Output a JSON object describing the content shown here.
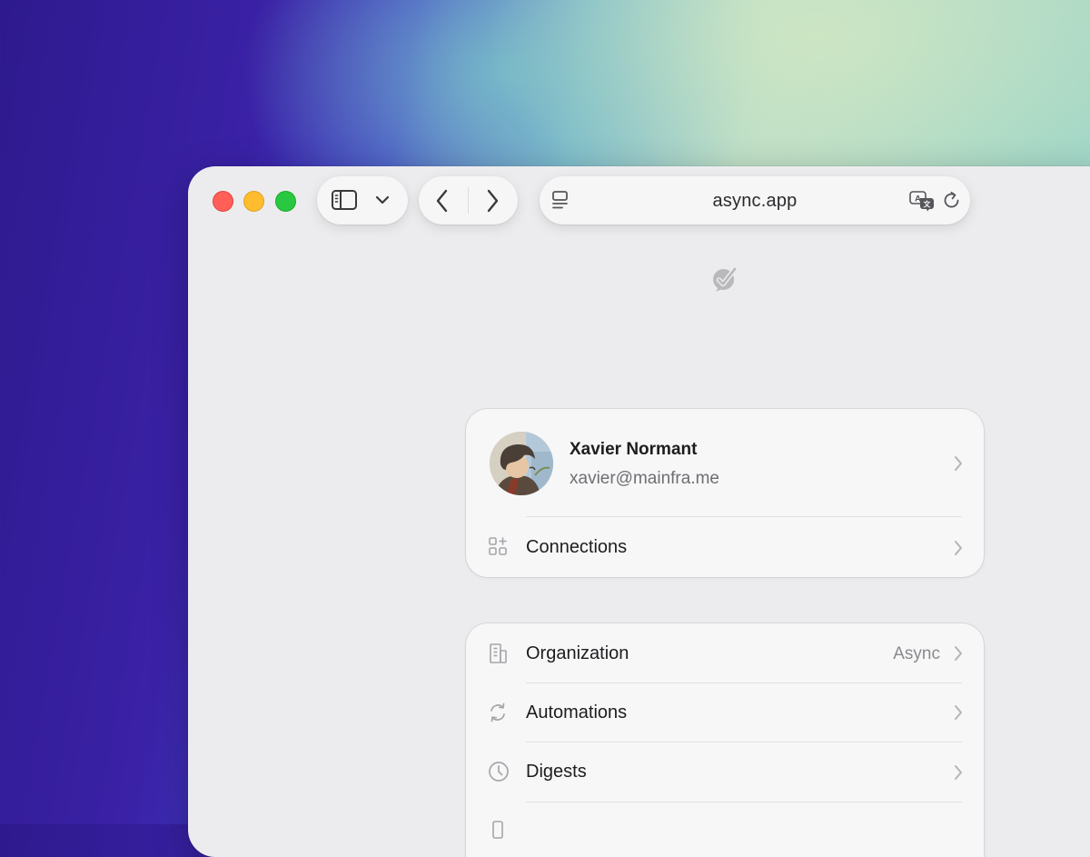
{
  "browser": {
    "url": "async.app",
    "icons": {
      "sidebar": "sidebar-icon",
      "sidebar_menu": "chevron-down-icon",
      "back": "chevron-left-icon",
      "forward": "chevron-right-icon",
      "page_menu": "page-menu-icon",
      "translate": "translate-icon",
      "reload": "reload-icon"
    }
  },
  "app": {
    "logo_icon": "check-badge-icon"
  },
  "profile": {
    "name": "Xavier Normant",
    "email": "xavier@mainfra.me"
  },
  "profile_menu": [
    {
      "label": "Connections",
      "icon": "grid-plus-icon"
    }
  ],
  "settings_menu": [
    {
      "label": "Organization",
      "value": "Async",
      "icon": "building-icon"
    },
    {
      "label": "Automations",
      "value": "",
      "icon": "refresh-icon"
    },
    {
      "label": "Digests",
      "value": "",
      "icon": "clock-icon"
    }
  ],
  "colors": {
    "close": "#ff5f57",
    "minimize": "#febc2e",
    "zoom": "#28c840"
  }
}
